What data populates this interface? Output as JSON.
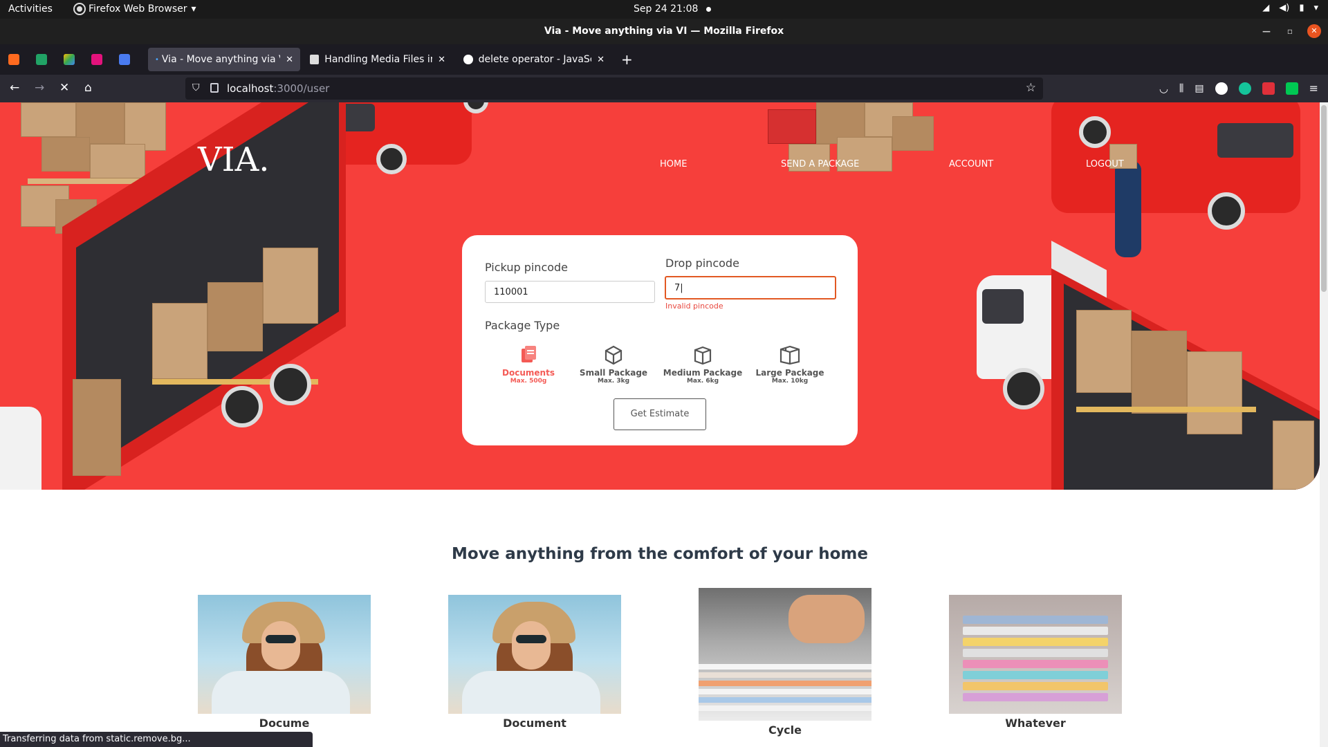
{
  "system_bar": {
    "activities": "Activities",
    "app_name": "Firefox Web Browser",
    "clock": "Sep 24  21:08"
  },
  "window": {
    "title": "Via - Move anything via VI — Mozilla Firefox"
  },
  "tabs": [
    {
      "label": "Via - Move anything via VI",
      "active": true
    },
    {
      "label": "Handling Media Files in D",
      "active": false
    },
    {
      "label": "delete operator - JavaScr",
      "active": false
    }
  ],
  "address_bar": {
    "host": "localhost",
    "path": ":3000/user"
  },
  "site": {
    "logo": "VIA.",
    "nav": [
      "HOME",
      "SEND A PACKAGE",
      "ACCOUNT",
      "LOGOUT"
    ]
  },
  "estimate_form": {
    "pickup_label": "Pickup pincode",
    "pickup_value": "110001",
    "drop_label": "Drop pincode",
    "drop_value": "7|",
    "drop_error": "Invalid pincode",
    "package_type_label": "Package Type",
    "packages": [
      {
        "name": "Documents",
        "max": "Max. 500g",
        "selected": true,
        "icon": "documents-icon"
      },
      {
        "name": "Small Package",
        "max": "Max. 3kg",
        "selected": false,
        "icon": "small-box-icon"
      },
      {
        "name": "Medium Package",
        "max": "Max. 6kg",
        "selected": false,
        "icon": "medium-box-icon"
      },
      {
        "name": "Large Package",
        "max": "Max. 10kg",
        "selected": false,
        "icon": "large-box-icon"
      }
    ],
    "submit_label": "Get Estimate"
  },
  "section": {
    "title": "Move anything from the comfort of your home",
    "cards": [
      {
        "caption": "Docume"
      },
      {
        "caption": "Document"
      },
      {
        "caption": "Cycle"
      },
      {
        "caption": "Whatever"
      }
    ]
  },
  "status_bar": {
    "text": "Transferring data from static.remove.bg..."
  },
  "colors": {
    "hero_red": "#f63f3b",
    "accent": "#f45a55",
    "error": "#e8483f"
  }
}
